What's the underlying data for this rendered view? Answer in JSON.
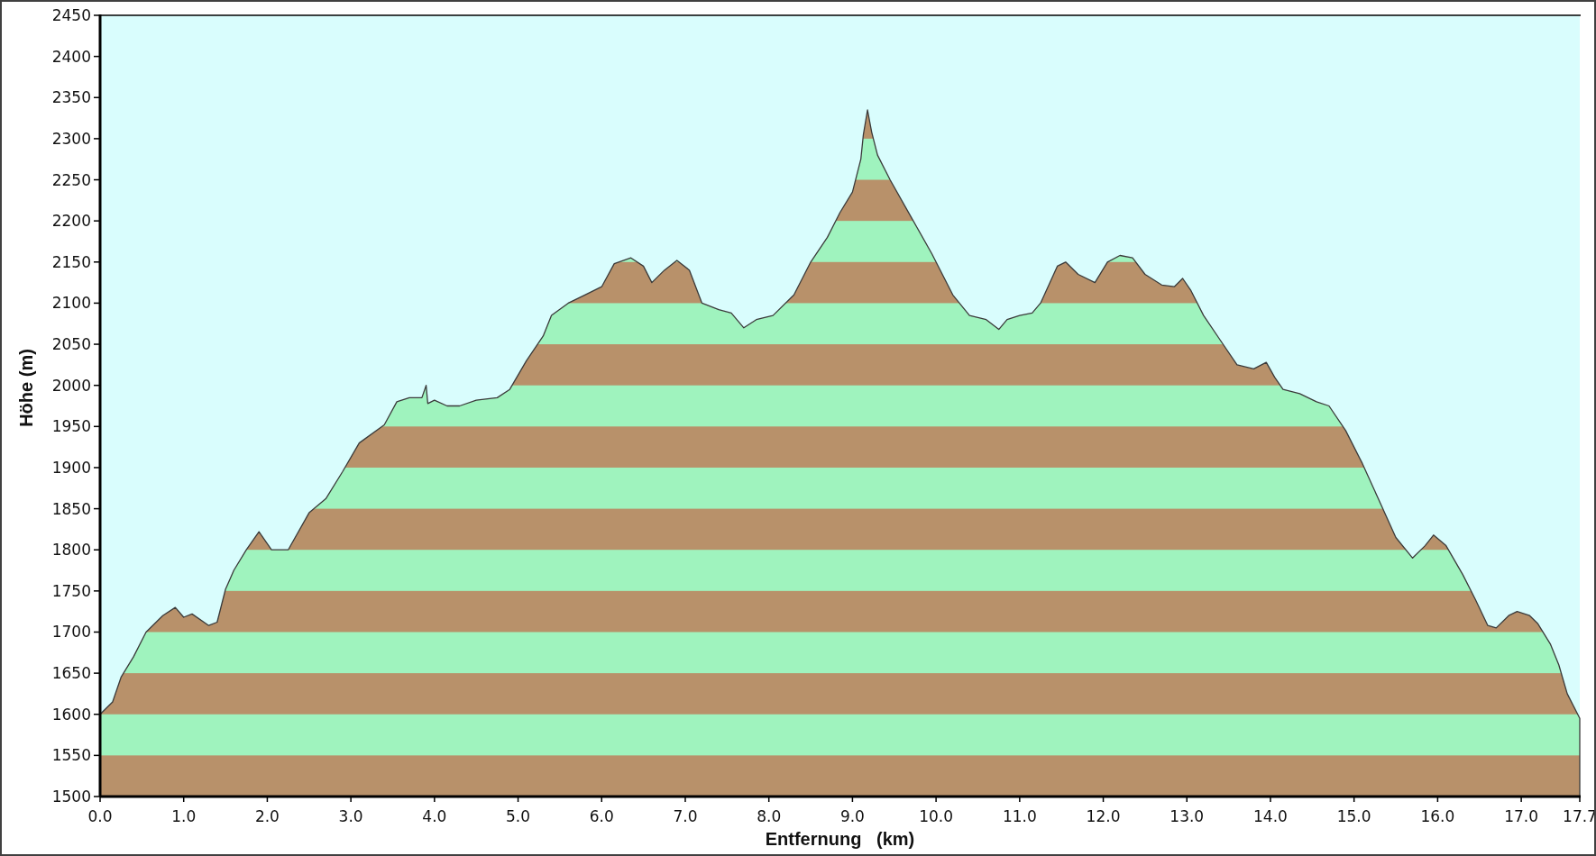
{
  "chart": {
    "chart_data": {
      "type": "area",
      "xlabel": "Entfernung   (km)",
      "ylabel": "Höhe (m)",
      "x": [
        0.0,
        0.15,
        0.25,
        0.4,
        0.55,
        0.75,
        0.9,
        1.0,
        1.1,
        1.3,
        1.4,
        1.5,
        1.6,
        1.75,
        1.9,
        2.05,
        2.25,
        2.5,
        2.7,
        2.9,
        3.1,
        3.4,
        3.55,
        3.7,
        3.85,
        3.9,
        3.92,
        4.0,
        4.15,
        4.3,
        4.5,
        4.75,
        4.9,
        5.1,
        5.3,
        5.4,
        5.6,
        5.8,
        6.0,
        6.15,
        6.35,
        6.5,
        6.6,
        6.75,
        6.9,
        7.05,
        7.2,
        7.4,
        7.55,
        7.7,
        7.85,
        8.05,
        8.3,
        8.5,
        8.7,
        8.85,
        9.0,
        9.1,
        9.13,
        9.18,
        9.23,
        9.3,
        9.45,
        9.7,
        9.95,
        10.2,
        10.4,
        10.6,
        10.75,
        10.85,
        11.0,
        11.15,
        11.25,
        11.45,
        11.55,
        11.7,
        11.9,
        12.05,
        12.2,
        12.35,
        12.5,
        12.7,
        12.85,
        12.95,
        13.05,
        13.2,
        13.4,
        13.6,
        13.8,
        13.95,
        14.05,
        14.15,
        14.35,
        14.55,
        14.7,
        14.9,
        15.1,
        15.3,
        15.5,
        15.7,
        15.85,
        15.95,
        16.1,
        16.3,
        16.45,
        16.6,
        16.7,
        16.85,
        16.95,
        17.1,
        17.2,
        17.35,
        17.45,
        17.55,
        17.7
      ],
      "series": [
        {
          "values": [
            1600,
            1615,
            1645,
            1670,
            1700,
            1720,
            1730,
            1718,
            1722,
            1708,
            1712,
            1752,
            1775,
            1800,
            1822,
            1800,
            1800,
            1845,
            1862,
            1895,
            1930,
            1952,
            1980,
            1985,
            1985,
            2000,
            1978,
            1982,
            1975,
            1975,
            1982,
            1985,
            1995,
            2030,
            2060,
            2085,
            2100,
            2110,
            2120,
            2148,
            2155,
            2145,
            2125,
            2140,
            2152,
            2140,
            2100,
            2092,
            2088,
            2070,
            2080,
            2085,
            2110,
            2150,
            2180,
            2210,
            2235,
            2275,
            2305,
            2335,
            2308,
            2280,
            2250,
            2205,
            2160,
            2110,
            2085,
            2080,
            2068,
            2080,
            2085,
            2088,
            2100,
            2145,
            2150,
            2135,
            2125,
            2150,
            2158,
            2155,
            2135,
            2122,
            2120,
            2130,
            2115,
            2085,
            2055,
            2025,
            2020,
            2028,
            2010,
            1995,
            1990,
            1980,
            1975,
            1945,
            1905,
            1860,
            1815,
            1790,
            1805,
            1818,
            1805,
            1770,
            1740,
            1708,
            1705,
            1720,
            1725,
            1720,
            1710,
            1685,
            1660,
            1625,
            1595
          ]
        }
      ],
      "xlim": [
        0,
        17.7
      ],
      "ylim": [
        1500,
        2450
      ],
      "xticks": [
        {
          "value": 0,
          "label": "0.0"
        },
        {
          "value": 1,
          "label": "1.0"
        },
        {
          "value": 2,
          "label": "2.0"
        },
        {
          "value": 3,
          "label": "3.0"
        },
        {
          "value": 4,
          "label": "4.0"
        },
        {
          "value": 5,
          "label": "5.0"
        },
        {
          "value": 6,
          "label": "6.0"
        },
        {
          "value": 7,
          "label": "7.0"
        },
        {
          "value": 8,
          "label": "8.0"
        },
        {
          "value": 9,
          "label": "9.0"
        },
        {
          "value": 10,
          "label": "10.0"
        },
        {
          "value": 11,
          "label": "11.0"
        },
        {
          "value": 12,
          "label": "12.0"
        },
        {
          "value": 13,
          "label": "13.0"
        },
        {
          "value": 14,
          "label": "14.0"
        },
        {
          "value": 15,
          "label": "15.0"
        },
        {
          "value": 16,
          "label": "16.0"
        },
        {
          "value": 17,
          "label": "17.0"
        },
        {
          "value": 17.7,
          "label": "17.7"
        }
      ],
      "yticks": [
        1500,
        1550,
        1600,
        1650,
        1700,
        1750,
        1800,
        1850,
        1900,
        1950,
        2000,
        2050,
        2100,
        2150,
        2200,
        2250,
        2300,
        2350,
        2400,
        2450
      ]
    }
  }
}
